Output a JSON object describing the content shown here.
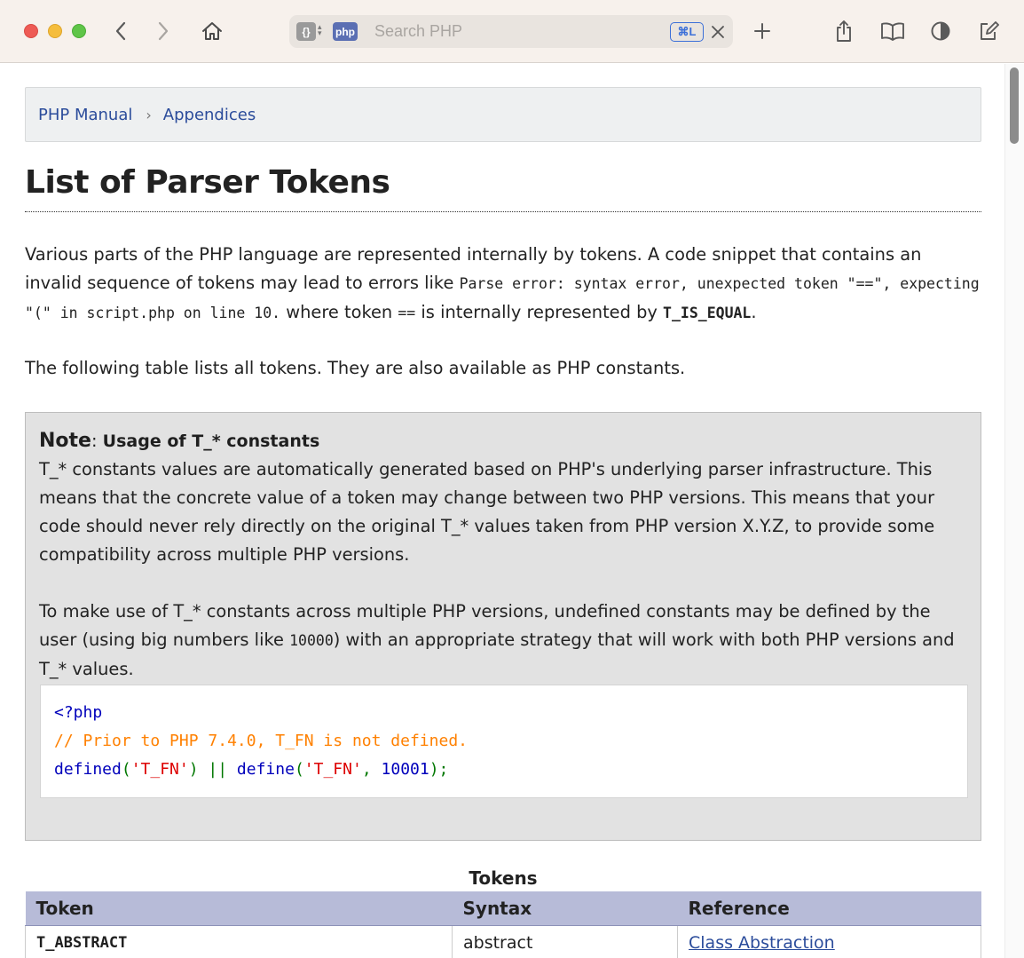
{
  "toolbar": {
    "search_placeholder": "Search PHP",
    "extension_chip_1": "{}",
    "extension_chip_2": "php",
    "shortcut_badge": "⌘L"
  },
  "breadcrumb": {
    "items": [
      "PHP Manual",
      "Appendices"
    ],
    "separator": "›"
  },
  "page": {
    "title": "List of Parser Tokens",
    "intro": {
      "text_1": "Various parts of the PHP language are represented internally by tokens. A code snippet that contains an invalid sequence of tokens may lead to errors like ",
      "code_1": "Parse error: syntax error, unexpected token \"==\", expecting \"(\" in script.php on line 10.",
      "text_2": " where token ",
      "code_2": "==",
      "text_3": " is internally represented by ",
      "code_3": "T_IS_EQUAL",
      "text_4": "."
    },
    "table_intro": "The following table lists all tokens. They are also available as PHP constants."
  },
  "note": {
    "label": "Note",
    "colon": ": ",
    "title": "Usage of T_* constants",
    "paragraph_1": "T_* constants values are automatically generated based on PHP's underlying parser infrastructure. This means that the concrete value of a token may change between two PHP versions. This means that your code should never rely directly on the original T_* values taken from PHP version X.Y.Z, to provide some compatibility across multiple PHP versions.",
    "paragraph_2_a": "To make use of T_* constants across multiple PHP versions, undefined constants may be defined by the user (using big numbers like ",
    "paragraph_2_code": "10000",
    "paragraph_2_b": ") with an appropriate strategy that will work with both PHP versions and T_* values.",
    "code": {
      "line_1": "<?php",
      "line_2": "// Prior to PHP 7.4.0, T_FN is not defined.",
      "line_3_fn1": "defined",
      "line_3_p1": "(",
      "line_3_s1": "'T_FN'",
      "line_3_op": ") || ",
      "line_3_fn2": "define",
      "line_3_p2": "(",
      "line_3_s2": "'T_FN'",
      "line_3_comma": ", ",
      "line_3_num": "10001",
      "line_3_end": ");"
    }
  },
  "tokens_table": {
    "caption": "Tokens",
    "headers": [
      "Token",
      "Syntax",
      "Reference"
    ],
    "rows": [
      {
        "token": "T_ABSTRACT",
        "syntax": "abstract",
        "reference": "Class Abstraction"
      }
    ]
  },
  "colors": {
    "link": "#2b4c9b",
    "table_header": "#b7bbd8",
    "note_bg": "#e2e2e2",
    "code_keyword": "#0000bb",
    "code_comment": "#ff8000",
    "code_string": "#dd0000",
    "code_operator": "#007700"
  }
}
